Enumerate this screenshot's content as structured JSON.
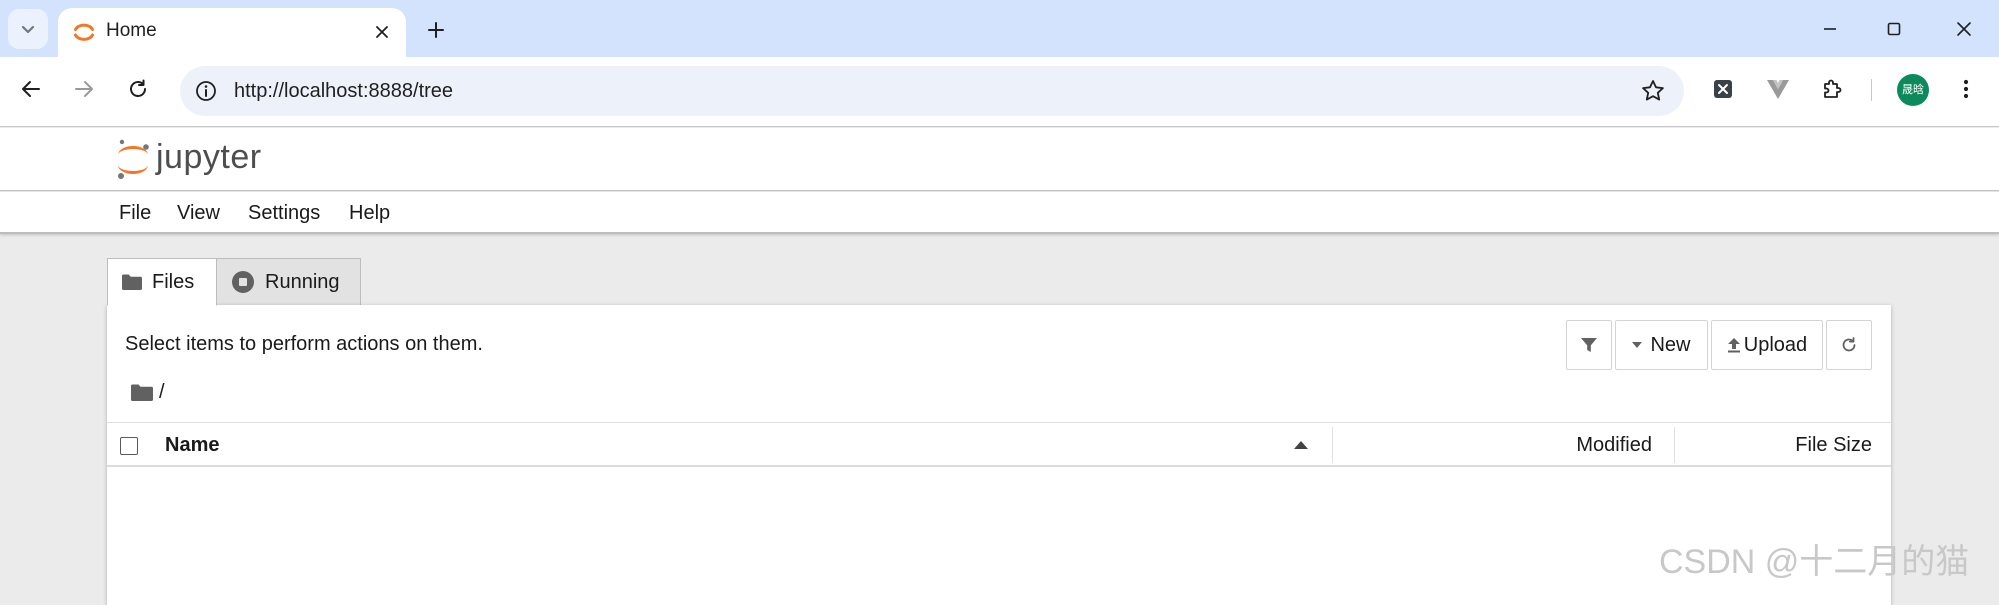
{
  "browser": {
    "tab": {
      "title": "Home",
      "favicon": "jupyter-icon"
    },
    "address": {
      "url": "http://localhost:8888/tree"
    },
    "profile": {
      "initials": "晟晗"
    },
    "extensions": [
      "x-extension-icon",
      "vue-devtools-icon",
      "puzzle-extensions-icon"
    ]
  },
  "jupyter": {
    "logo_text": "jupyter",
    "menu": [
      "File",
      "View",
      "Settings",
      "Help"
    ],
    "tabs": [
      {
        "label": "Files",
        "icon": "folder-icon",
        "active": true
      },
      {
        "label": "Running",
        "icon": "stop-circle-icon",
        "active": false
      }
    ],
    "hint": "Select items to perform actions on them.",
    "toolbar": {
      "new_label": "New",
      "upload_label": "Upload"
    },
    "breadcrumb": {
      "path": "/"
    },
    "columns": {
      "name": "Name",
      "modified": "Modified",
      "size": "File Size"
    },
    "sort": {
      "column": "Name",
      "direction": "ascending"
    }
  },
  "watermark": "CSDN @十二月的猫",
  "colors": {
    "tabstrip": "#d3e3fd",
    "omnibox": "#edf2fa",
    "jupyter_orange": "#f37726",
    "page_bg": "#ebebeb",
    "avatar": "#0d8a5c"
  }
}
